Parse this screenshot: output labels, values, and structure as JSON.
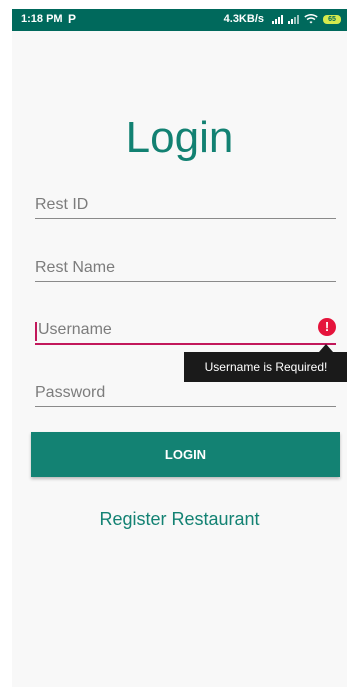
{
  "status_bar": {
    "time": "1:18 PM",
    "carrier_icon": "P",
    "net_speed": "4.3KB/s",
    "battery": "65",
    "icons": [
      "signal-icon",
      "wifi-icon",
      "battery-icon"
    ]
  },
  "screen": {
    "title": "Login"
  },
  "form": {
    "rest_id_placeholder": "Rest ID",
    "rest_name_placeholder": "Rest Name",
    "username_placeholder": "Username",
    "password_placeholder": "Password",
    "username_error": "Username is Required!",
    "error_icon": "!"
  },
  "actions": {
    "login_label": "LOGIN",
    "register_label": "Register Restaurant"
  },
  "colors": {
    "status_bar": "#00695c",
    "accent": "#138273",
    "error": "#e5143c"
  }
}
